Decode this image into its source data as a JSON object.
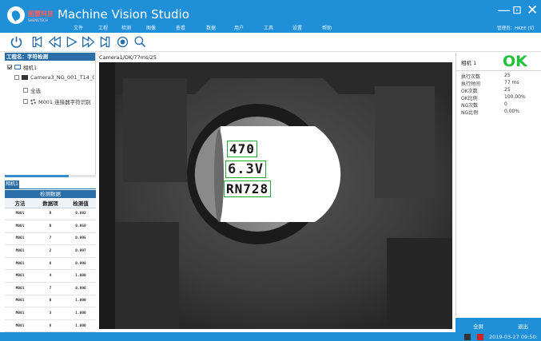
{
  "header": {
    "brand_cn": "图慧科技",
    "brand_en": "SHENGTECH",
    "title": "Machine Vision Studio",
    "menu": [
      "文件",
      "工程",
      "检测",
      "图像",
      "查看",
      "数据",
      "用户",
      "工具",
      "设置",
      "帮助"
    ],
    "user_info": "管理员：HKEE",
    "user_info_clipped": "[切",
    "minimize": "—",
    "maximize": "⊡",
    "close": "✕"
  },
  "toolbar": {
    "buttons": [
      "power-icon",
      "first-frame-icon",
      "previous-icon",
      "play-icon",
      "next-icon",
      "last-frame-icon",
      "record-icon",
      "zoom-icon"
    ]
  },
  "project": {
    "header": "工程名：字符检测",
    "camera_node": "相机1",
    "camera_child": "Camera3_NG_001_T14_003",
    "select_all": "全选",
    "tool_item": "M001  连接器字符识别"
  },
  "camera_tab": "相机1",
  "detection": {
    "title": "检测数据",
    "columns": [
      "方法",
      "数据项",
      "检测值"
    ],
    "rows": [
      [
        "M001",
        "R",
        "0.882"
      ],
      [
        "M001",
        "N",
        "0.958"
      ],
      [
        "M001",
        "7",
        "0.995"
      ],
      [
        "M001",
        "2",
        "0.997"
      ],
      [
        "M001",
        "8",
        "0.998"
      ],
      [
        "M001",
        "4",
        "1.000"
      ],
      [
        "M001",
        "7",
        "0.996"
      ],
      [
        "M001",
        "0",
        "1.000"
      ],
      [
        "M001",
        "3",
        "1.000"
      ],
      [
        "M001",
        "V",
        "1.000"
      ]
    ]
  },
  "viewer": {
    "label": "Camera1/OK/77ms/25",
    "ocr_lines": [
      "470",
      "6.3V",
      "RN728"
    ]
  },
  "stats": {
    "camera_name": "相机 1",
    "result": "OK",
    "result_color": "#22c23a",
    "rows": [
      {
        "label": "执行次数",
        "value": "25"
      },
      {
        "label": "执行时间",
        "value": "77 ms"
      },
      {
        "label": "OK次数",
        "value": "25"
      },
      {
        "label": "OK比例",
        "value": "100.00%"
      },
      {
        "label": "NG次数",
        "value": "0"
      },
      {
        "label": "NG比例",
        "value": "0.00%"
      }
    ]
  },
  "footer": {
    "fullscreen": "全屏",
    "exit": "退出",
    "datetime": "2019-03-27 09:50:"
  },
  "colors": {
    "accent": "#1f8fd8",
    "header_dark": "#2a6ea8",
    "ocr_box": "#1faa3c"
  }
}
